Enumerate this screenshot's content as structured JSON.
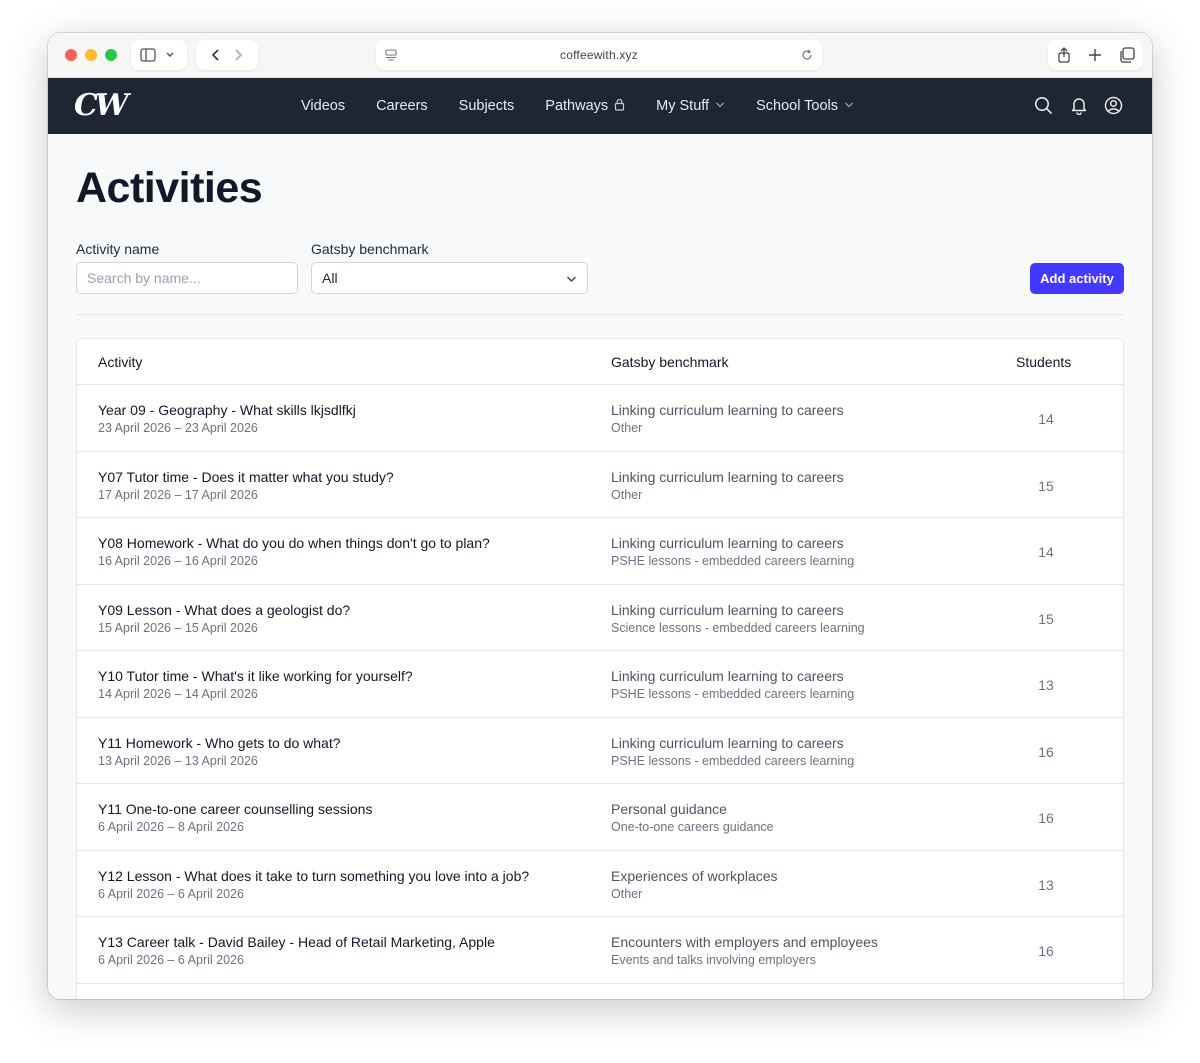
{
  "browser": {
    "url": "coffeewith.xyz"
  },
  "navbar": {
    "logo": "CW",
    "links": [
      {
        "label": "Videos"
      },
      {
        "label": "Careers"
      },
      {
        "label": "Subjects"
      },
      {
        "label": "Pathways",
        "icon": "lock-icon"
      },
      {
        "label": "My Stuff",
        "icon": "chevron-down-icon"
      },
      {
        "label": "School Tools",
        "icon": "chevron-down-icon"
      }
    ]
  },
  "page": {
    "title": "Activities"
  },
  "filters": {
    "name_label": "Activity name",
    "name_placeholder": "Search by name...",
    "gatsby_label": "Gatsby benchmark",
    "gatsby_value": "All",
    "add_button": "Add activity"
  },
  "table": {
    "headers": {
      "activity": "Activity",
      "gatsby": "Gatsby benchmark",
      "students": "Students"
    },
    "rows": [
      {
        "title": "Year 09 - Geography - What skills lkjsdlfkj",
        "dates": "23 April 2026 – 23 April 2026",
        "benchmark": "Linking curriculum learning to careers",
        "sub": "Other",
        "students": "14"
      },
      {
        "title": "Y07 Tutor time - Does it matter what you study?",
        "dates": "17 April 2026 – 17 April 2026",
        "benchmark": "Linking curriculum learning to careers",
        "sub": "Other",
        "students": "15"
      },
      {
        "title": "Y08 Homework - What do you do when things don't go to plan?",
        "dates": "16 April 2026 – 16 April 2026",
        "benchmark": "Linking curriculum learning to careers",
        "sub": "PSHE lessons - embedded careers learning",
        "students": "14"
      },
      {
        "title": "Y09 Lesson - What does a geologist do?",
        "dates": "15 April 2026 – 15 April 2026",
        "benchmark": "Linking curriculum learning to careers",
        "sub": "Science lessons - embedded careers learning",
        "students": "15"
      },
      {
        "title": "Y10 Tutor time - What's it like working for yourself?",
        "dates": "14 April 2026 – 14 April 2026",
        "benchmark": "Linking curriculum learning to careers",
        "sub": "PSHE lessons - embedded careers learning",
        "students": "13"
      },
      {
        "title": "Y11 Homework - Who gets to do what?",
        "dates": "13 April 2026 – 13 April 2026",
        "benchmark": "Linking curriculum learning to careers",
        "sub": "PSHE lessons - embedded careers learning",
        "students": "16"
      },
      {
        "title": "Y11 One-to-one career counselling sessions",
        "dates": "6 April 2026 – 8 April 2026",
        "benchmark": "Personal guidance",
        "sub": "One-to-one careers guidance",
        "students": "16"
      },
      {
        "title": "Y12 Lesson - What does it take to turn something you love into a job?",
        "dates": "6 April 2026 – 6 April 2026",
        "benchmark": "Experiences of workplaces",
        "sub": "Other",
        "students": "13"
      },
      {
        "title": "Y13 Career talk - David Bailey - Head of Retail Marketing, Apple",
        "dates": "6 April 2026 – 6 April 2026",
        "benchmark": "Encounters with employers and employees",
        "sub": "Events and talks involving employers",
        "students": "16"
      }
    ]
  },
  "colors": {
    "navbar_bg": "#1e2533",
    "primary": "#4338ff"
  }
}
